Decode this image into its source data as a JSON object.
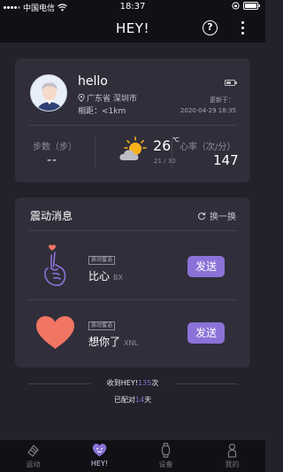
{
  "status_bar": {
    "carrier": "中国电信",
    "time": "18:37"
  },
  "header": {
    "title": "HEY!",
    "help_symbol": "?"
  },
  "profile": {
    "name": "hello",
    "location": "广东省 深圳市",
    "distance": "相距：<1km",
    "updated_label": "更新于：",
    "updated_time": "2020-04-29 18:35",
    "battery_level": 0.6
  },
  "stats": {
    "steps_label": "步数（步）",
    "steps_value": "--",
    "temperature": "26",
    "temp_unit": "℃",
    "temp_range": "21 / 30",
    "heart_rate_label": "心率（次/分）",
    "heart_rate_value": "147"
  },
  "vibration": {
    "title": "震动消息",
    "refresh_label": "换一换",
    "items": [
      {
        "badge": "震动蜜语",
        "text": "比心",
        "code": "BX",
        "button": "发送",
        "icon": "finger-heart-icon"
      },
      {
        "badge": "震动蜜语",
        "text": "想你了",
        "code": "XNL",
        "button": "发送",
        "icon": "heart-icon"
      }
    ]
  },
  "summary": {
    "received_prefix": "收到HEY!",
    "received_count": "135",
    "received_suffix": "次",
    "paired_prefix": "已配对",
    "paired_days": "14",
    "paired_suffix": "天"
  },
  "tabs": [
    {
      "label": "运动",
      "icon": "sport-icon",
      "active": false
    },
    {
      "label": "HEY!",
      "icon": "hey-heart-icon",
      "active": true
    },
    {
      "label": "设备",
      "icon": "watch-icon",
      "active": false
    },
    {
      "label": "我的",
      "icon": "person-icon",
      "active": false
    }
  ],
  "colors": {
    "background": "#232129",
    "card": "#302e3a",
    "accent": "#8b72d8",
    "heart": "#f07563",
    "bar": "#111015"
  }
}
